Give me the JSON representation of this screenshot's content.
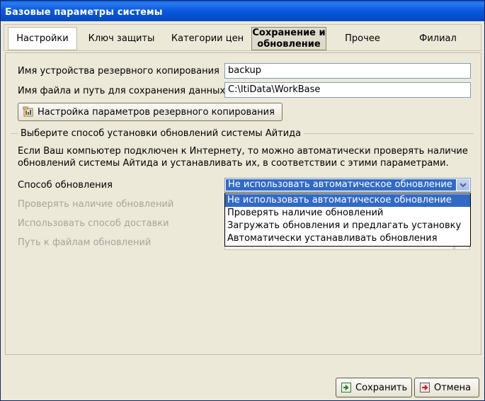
{
  "window": {
    "title": "Базовые параметры системы"
  },
  "tabs": [
    {
      "label": "Настройки"
    },
    {
      "label": "Ключ защиты"
    },
    {
      "label": "Категории цен"
    },
    {
      "label": "Сохранение и обновление"
    },
    {
      "label": "Прочее"
    },
    {
      "label": "Филиал"
    }
  ],
  "backup": {
    "device_label": "Имя устройства резервного копирования",
    "device_value": "backup",
    "path_label": "Имя файла и путь для сохранения данных",
    "path_value": "C:\\ItiData\\WorkBase",
    "settings_button": "Настройка параметров резервного копирования"
  },
  "updates": {
    "group_title": "Выберите способ установки обновлений системы Айтида",
    "description_line1": "Если Ваш компьютер подключен к Интернету, то можно автоматически проверять наличие",
    "description_line2": "обновлений системы Айтида и устанавливать их, в соответствии с этими параметрами.",
    "method_label": "Способ обновления",
    "check_label": "Проверять наличие обновлений",
    "delivery_label": "Использовать способ доставки",
    "path_label": "Путь к файлам обновлений",
    "selected_method": "Не использовать автоматическое обновление",
    "options": [
      "Не использовать автоматическое обновление",
      "Проверять наличие обновлений",
      "Загружать обновления и предлагать установку",
      "Автоматически устанавливать обновления"
    ]
  },
  "footer": {
    "save_label": "Сохранить",
    "cancel_label": "Отмена"
  },
  "colors": {
    "titlebar": "#0a5fd8",
    "selection": "#316ac5",
    "face": "#ece9d8"
  }
}
